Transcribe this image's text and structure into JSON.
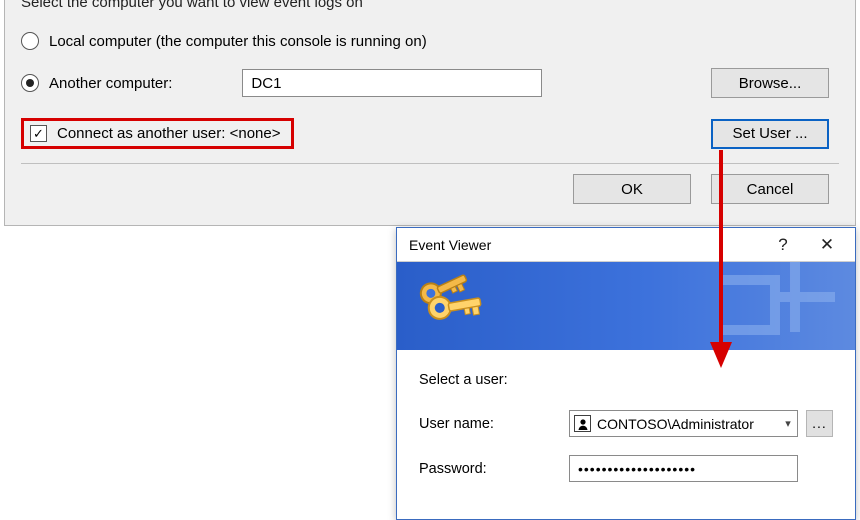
{
  "bg": {
    "cropped_title": "Select the computer you want to view event logs on",
    "radio_local_label": "Local computer (the computer this console is running on)",
    "radio_remote_label": "Another computer:",
    "computer_value": "DC1",
    "browse_label": "Browse...",
    "connect_as_label": "Connect as another user: <none>",
    "set_user_label": "Set User ...",
    "ok_label": "OK",
    "cancel_label": "Cancel"
  },
  "ev": {
    "title": "Event Viewer",
    "help_glyph": "?",
    "close_glyph": "✕",
    "prompt": "Select a user:",
    "username_label": "User name:",
    "username_value": "CONTOSO\\Administrator",
    "password_label": "Password:",
    "password_value": "••••••••••••••••••••",
    "lookup_glyph": "..."
  },
  "colors": {
    "highlight": "#d60000",
    "focus": "#0a62c4"
  }
}
